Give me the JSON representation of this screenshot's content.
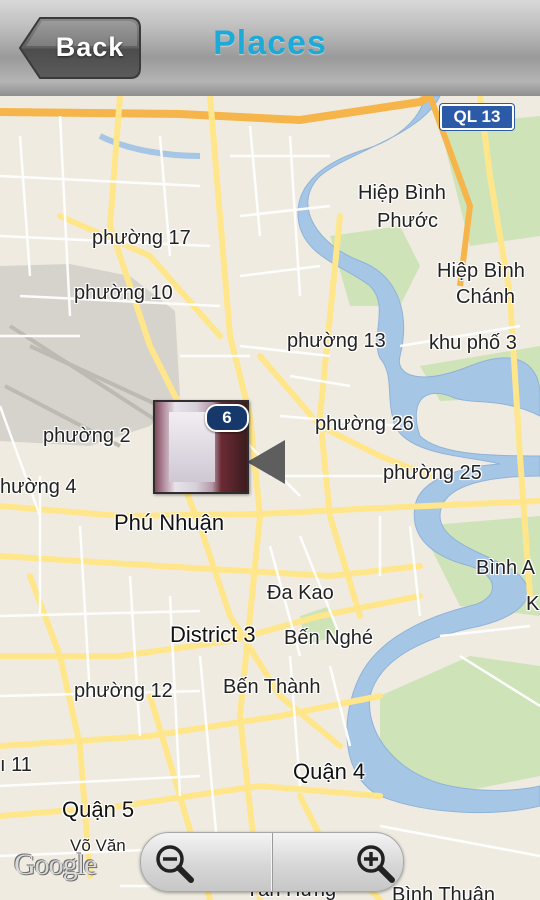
{
  "header": {
    "back_label": "Back",
    "title": "Places"
  },
  "map": {
    "route_shield": "QL 13",
    "labels": {
      "hiep_binh_phuoc_1": "Hiệp Bình",
      "hiep_binh_phuoc_2": "Phước",
      "hiep_binh_chanh_1": "Hiệp Bình",
      "hiep_binh_chanh_2": "Chánh",
      "phuong_17": "phường 17",
      "phuong_10": "phường 10",
      "phuong_13": "phường 13",
      "khu_pho_3": "khu phố 3",
      "phuong_2": "phường 2",
      "phuong_26": "phường 26",
      "phuong_4": "hường 4",
      "phuong_25": "phường 25",
      "phu_nhuan": "Phú Nhuận",
      "binh_a": "Bình A",
      "k": "K",
      "da_kao": "Đa Kao",
      "district_3": "District 3",
      "ben_nghe": "Bến Nghé",
      "phuong_12": "phường 12",
      "ben_thanh": "Bến Thành",
      "u_11": "ı 11",
      "quan_4": "Quận 4",
      "quan_5": "Quận 5",
      "vo_van": "Võ Văn",
      "tan_hung": "Tân Hưng",
      "binh_thuan": "Bình Thuận"
    },
    "marker": {
      "count": "6"
    },
    "attribution": "Google",
    "colors": {
      "water": "#a6c6e6",
      "land": "#efebe1",
      "park": "#cfe3b8",
      "road_major": "#ffe68a",
      "highway": "#f6b54a"
    }
  },
  "zoom": {
    "out_icon": "zoom-out-icon",
    "in_icon": "zoom-in-icon"
  }
}
